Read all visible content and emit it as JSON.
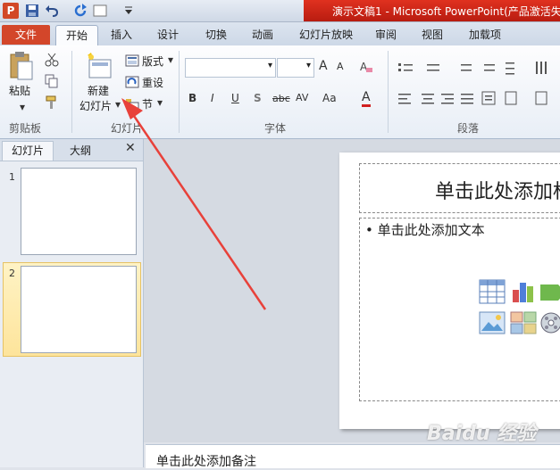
{
  "app": {
    "title": "演示文稿1 - Microsoft PowerPoint(产品激活失"
  },
  "tabs": [
    "文件",
    "开始",
    "插入",
    "设计",
    "切换",
    "动画",
    "幻灯片放映",
    "审阅",
    "视图",
    "加载项"
  ],
  "ribbon": {
    "clipboard": {
      "paste": "粘贴",
      "label": "剪贴板"
    },
    "slides": {
      "new_slide_line1": "新建",
      "new_slide_line2": "幻灯片",
      "layout": "版式",
      "reset": "重设",
      "section": "节",
      "label": "幻灯片"
    },
    "font": {
      "label": "字体",
      "bold": "B",
      "italic": "I",
      "underline": "U",
      "shadow": "S",
      "strike": "abc",
      "spacing": "AV",
      "case": "Aa",
      "grow": "A",
      "shrink": "A",
      "color": "A"
    },
    "paragraph": {
      "label": "段落"
    }
  },
  "left_panel": {
    "tab_slides": "幻灯片",
    "tab_outline": "大纲",
    "close": "✕",
    "slide_numbers": [
      "1",
      "2"
    ]
  },
  "slide": {
    "title_placeholder": "单击此处添加标",
    "content_placeholder": "• 单击此处添加文本"
  },
  "notes": {
    "placeholder": "单击此处添加备注"
  },
  "watermark": "Baidu 经验",
  "colors": {
    "accent_red": "#d3462a",
    "arrow": "#e8413a"
  }
}
